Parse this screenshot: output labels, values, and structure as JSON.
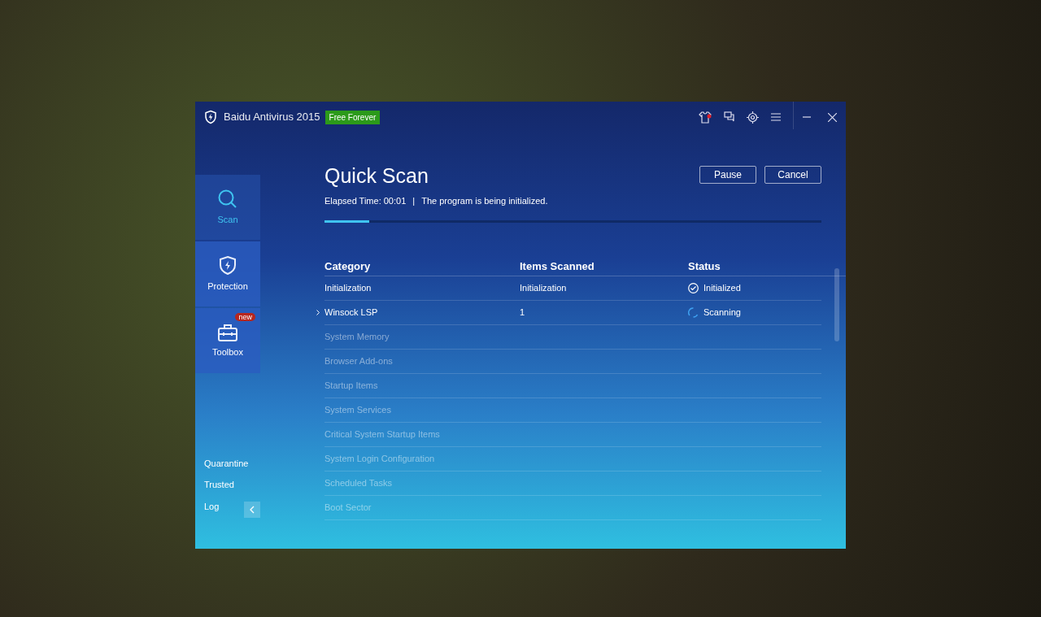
{
  "window": {
    "title": "Baidu Antivirus 2015",
    "badge": "Free Forever"
  },
  "nav": [
    {
      "label": "Scan",
      "selected": true
    },
    {
      "label": "Protection",
      "selected": false
    },
    {
      "label": "Toolbox",
      "selected": false,
      "badge": "new"
    }
  ],
  "links": [
    "Quarantine",
    "Trusted",
    "Log"
  ],
  "scan": {
    "title": "Quick Scan",
    "elapsed": "Elapsed Time: 00:01",
    "separator": "|",
    "message": "The program is being initialized.",
    "level": 0.09,
    "buttons": [
      "Pause",
      "Cancel"
    ]
  },
  "table": {
    "columns": [
      "Category",
      "Items Scanned",
      "Status"
    ],
    "rows": [
      {
        "category": "Initialization",
        "items": "Initialization",
        "status": "Initialized",
        "kind": "done"
      },
      {
        "category": "Winsock LSP",
        "items": "1",
        "status": "Scanning",
        "kind": "active"
      },
      {
        "category": "System Memory",
        "kind": "pending"
      },
      {
        "category": "Browser Add-ons",
        "kind": "pending"
      },
      {
        "category": "Startup Items",
        "kind": "pending"
      },
      {
        "category": "System Services",
        "kind": "pending"
      },
      {
        "category": "Critical System Startup Items",
        "kind": "pending"
      },
      {
        "category": "System Login Configuration",
        "kind": "pending"
      },
      {
        "category": "Scheduled Tasks",
        "kind": "pending"
      },
      {
        "category": "Boot Sector",
        "kind": "pending"
      }
    ]
  }
}
